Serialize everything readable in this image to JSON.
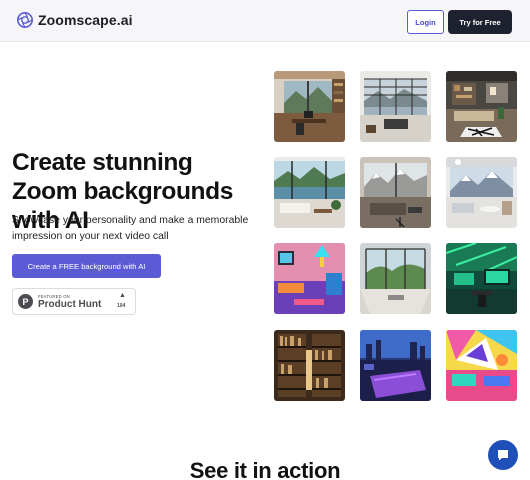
{
  "header": {
    "brand": "Zoomscape.ai",
    "login_label": "Login",
    "try_label": "Try for Free"
  },
  "hero": {
    "title": "Create stunning Zoom backgrounds with AI",
    "subtitle": "Showcase your personality and make a memorable impression on your next video call",
    "cta_label": "Create a FREE background with AI"
  },
  "product_hunt": {
    "featured": "FEATURED ON",
    "name": "Product Hunt",
    "votes": "104"
  },
  "gallery": {
    "tiles": [
      {
        "scene": "office-mountain-view"
      },
      {
        "scene": "japanese-window-lake"
      },
      {
        "scene": "modern-living-room"
      },
      {
        "scene": "lake-living-room"
      },
      {
        "scene": "mountain-window-sofa"
      },
      {
        "scene": "snowy-mountain-lounge"
      },
      {
        "scene": "neon-retro-room"
      },
      {
        "scene": "glass-wall-garden"
      },
      {
        "scene": "green-neon-office"
      },
      {
        "scene": "library-bookshelves"
      },
      {
        "scene": "rooftop-night-pool"
      },
      {
        "scene": "colorful-abstract-art"
      }
    ]
  },
  "section": {
    "title": "See it in action"
  },
  "colors": {
    "accent": "#5b5bd6",
    "dark_button": "#1e2230",
    "chat": "#1f4fb8"
  }
}
